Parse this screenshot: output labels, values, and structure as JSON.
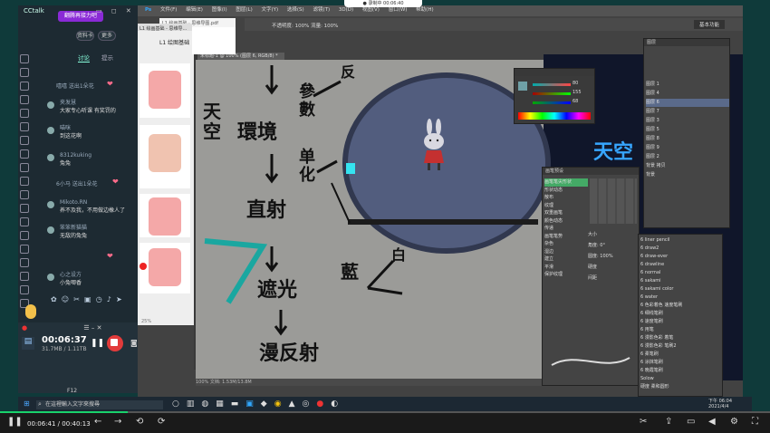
{
  "recording_indicator": "● 录制中 00:06:40",
  "cctalk": {
    "title": "CCtalk",
    "live_badge": "翻腾再接力吧",
    "window_buttons": "▭ ◻ ✕",
    "btn_profile": "资料卡",
    "btn_more": "更多",
    "tabs": [
      "讨论",
      "提示"
    ],
    "messages": [
      {
        "user": "嘻嘻 送出1朵花",
        "text": ""
      },
      {
        "user": "夹发慧",
        "text": "大家专心听课 有奖罚的"
      },
      {
        "user": "喵咪",
        "text": "到这花啊"
      },
      {
        "user": "8312kuking",
        "text": "兔兔"
      },
      {
        "user": "6小马 送出1朵花",
        "text": ""
      },
      {
        "user": "Mikoto.RN",
        "text": "养不及我，不用做边橡人了"
      },
      {
        "user": "笨笨新猫猫",
        "text": "无敌的兔兔"
      },
      {
        "user": "心之设方",
        "text": "小兔唧香"
      }
    ]
  },
  "recorder": {
    "time": "00:06:37",
    "size": "31.7MB / 1.11TB",
    "hotkey": "F12"
  },
  "docs": {
    "tab_left": "L1 绘画基础 - 思维导...",
    "tab_right": "L1 绘画基础 · 思维导图.pdf",
    "page_title": "L1 绘图基础",
    "status": "25%"
  },
  "photoshop": {
    "menu": [
      "文件(F)",
      "编辑(E)",
      "图像(I)",
      "图层(L)",
      "文字(Y)",
      "选择(S)",
      "滤镜(T)",
      "3D(D)",
      "视图(V)",
      "窗口(W)",
      "帮助(H)"
    ],
    "options": "不透明度: 100%   流量: 100%",
    "workspace": "基本功能",
    "canvas_title": "未标题-1 @ 100% (图层 6, RGB/8) *",
    "canvas_status": "100%     文档: 1.53M/13.8M",
    "color_values": [
      "80",
      "155",
      "68"
    ],
    "handwriting": [
      "天空",
      "環境",
      "參數",
      "单化",
      "直射",
      "遮光",
      "漫反射",
      "藍",
      "白",
      "反"
    ],
    "layers_title": "图层",
    "layers": [
      "图层 1",
      "图层 4",
      "图层 6",
      "图层 7",
      "图层 3",
      "图层 5",
      "图层 8",
      "图层 9",
      "图层 2",
      "背景 拷贝",
      "背景"
    ],
    "brush_panel_title": "画笔预设",
    "brush_settings": [
      "画笔笔尖形状",
      "形状动态",
      "散布",
      "纹理",
      "双重画笔",
      "颜色动态",
      "传递",
      "画笔笔势",
      "杂色",
      "湿边",
      "建立",
      "平滑",
      "保护纹理"
    ],
    "brush_values": [
      "大小",
      "角度: 0°",
      "圆度: 100%",
      "硬度",
      "间距"
    ],
    "brushes": [
      "6 liner pencil",
      "6 draw2",
      "6 draw-ever",
      "6 drawline",
      "6 normal",
      "6 sakami",
      "6 sakami color",
      "6 water",
      "6 色彩着色 速度笔刷",
      "6 细线笔刷",
      "6 速度笔刷",
      "6 用笔",
      "6 漫影色彩 着笔",
      "6 漫影色彩 笔刷2",
      "6 柔笔刷",
      "6 涂抹笔刷",
      "6 晚霞笔刷",
      "Solow",
      "硬度 柔和圆形"
    ],
    "canvas_right_text": "天空"
  },
  "taskbar": {
    "search_placeholder": "在這裡輸入文字來搜尋",
    "clock_time": "下午 06:04",
    "clock_date": "2021/4/4"
  },
  "video": {
    "current": "00:06:41",
    "total": "00:40:13",
    "time_label": "00:06:41 / 00:40:13",
    "progress": 0.166
  },
  "colors": {
    "accent_green": "#19d26b",
    "record_red": "#e23b3b",
    "ps_bg": "#424242"
  }
}
